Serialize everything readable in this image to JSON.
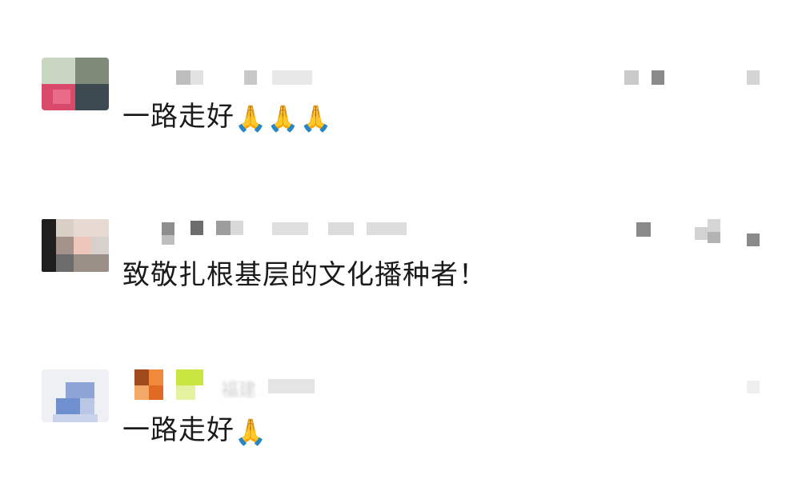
{
  "comments": [
    {
      "author": "",
      "text": "一路走好",
      "emoji": "🙏🙏🙏",
      "emoji_icon": "folded-hands-icon"
    },
    {
      "author": "",
      "text": "致敬扎根基层的文化播种者！"
    },
    {
      "author": "",
      "location_blurred": "福建",
      "text": "一路走好",
      "emoji": "🙏",
      "emoji_icon": "folded-hands-icon"
    }
  ],
  "colors": {
    "text": "#1b1b1b",
    "mosaic_gray": "#a8a8a8",
    "mosaic_orange": "#f08a3a",
    "mosaic_green": "#c8e640",
    "mosaic_blue": "#6f8fcf",
    "emoji_gold": "#e0a030"
  }
}
